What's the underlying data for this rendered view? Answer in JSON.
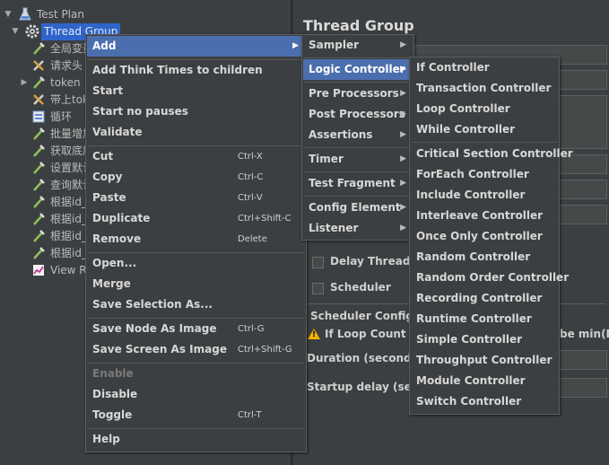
{
  "tree": {
    "root": "Test Plan",
    "selected": "Thread Group",
    "children": [
      "全局变量",
      "请求头",
      "token",
      "带上token",
      "循环",
      "批量增加",
      "获取底层",
      "设置默认",
      "查询默认",
      "根据id_",
      "根据id_",
      "根据id_",
      "根据id_",
      "View Results"
    ]
  },
  "right_panel": {
    "title": "Thread Group",
    "delay_thread": "Delay Thread cr",
    "scheduler": "Scheduler",
    "scheduler_config": "Scheduler Configura",
    "loop_warning": "If Loop Count is n",
    "loop_warning_tail": "be min(Du",
    "duration": "Duration (seconds)",
    "startup_delay": "Startup delay (secon"
  },
  "context_menu": {
    "add": "Add",
    "add_think_times": "Add Think Times to children",
    "start": "Start",
    "start_no_pauses": "Start no pauses",
    "validate": "Validate",
    "cut": "Cut",
    "cut_acc": "Ctrl-X",
    "copy": "Copy",
    "copy_acc": "Ctrl-C",
    "paste": "Paste",
    "paste_acc": "Ctrl-V",
    "duplicate": "Duplicate",
    "duplicate_acc": "Ctrl+Shift-C",
    "remove": "Remove",
    "remove_acc": "Delete",
    "open": "Open...",
    "merge": "Merge",
    "save_selection": "Save Selection As...",
    "save_node_image": "Save Node As Image",
    "save_node_image_acc": "Ctrl-G",
    "save_screen_image": "Save Screen As Image",
    "save_screen_image_acc": "Ctrl+Shift-G",
    "enable": "Enable",
    "disable": "Disable",
    "toggle": "Toggle",
    "toggle_acc": "Ctrl-T",
    "help": "Help"
  },
  "add_menu": {
    "sampler": "Sampler",
    "logic_controller": "Logic Controller",
    "pre_processors": "Pre Processors",
    "post_processors": "Post Processors",
    "assertions": "Assertions",
    "timer": "Timer",
    "test_fragment": "Test Fragment",
    "config_element": "Config Element",
    "listener": "Listener"
  },
  "logic_menu": {
    "if_controller": "If Controller",
    "transaction_controller": "Transaction Controller",
    "loop_controller": "Loop Controller",
    "while_controller": "While Controller",
    "critical_section_controller": "Critical Section Controller",
    "foreach_controller": "ForEach Controller",
    "include_controller": "Include Controller",
    "interleave_controller": "Interleave Controller",
    "once_only_controller": "Once Only Controller",
    "random_controller": "Random Controller",
    "random_order_controller": "Random Order Controller",
    "recording_controller": "Recording Controller",
    "runtime_controller": "Runtime Controller",
    "simple_controller": "Simple Controller",
    "throughput_controller": "Throughput Controller",
    "module_controller": "Module Controller",
    "switch_controller": "Switch Controller"
  },
  "colors": {
    "background": "#3c3f41",
    "selection": "#2f65ca",
    "menu_highlight": "#4b6eaf"
  },
  "icons": {
    "expanded": "triangle-down",
    "collapsed": "triangle-right",
    "submenu": "triangle-right"
  }
}
